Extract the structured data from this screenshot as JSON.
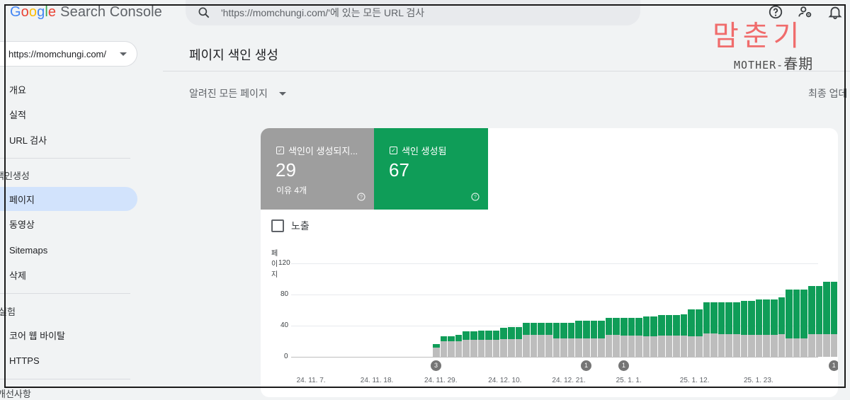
{
  "brand": {
    "logo_word": "Google",
    "product": "Search Console"
  },
  "search": {
    "placeholder": "'https://momchungi.com/'에 있는 모든 URL 검사"
  },
  "top_icons": [
    "help-icon",
    "account-settings-icon",
    "notifications-bell-icon"
  ],
  "property": {
    "label": "https://momchungi.com/"
  },
  "nav": {
    "overview": "개요",
    "performance": "실적",
    "url_inspection": "URL 검사",
    "section_indexing": "색인생성",
    "pages": "페이지",
    "videos": "동영상",
    "sitemaps": "Sitemaps",
    "removals": "삭제",
    "section_experience": "실험",
    "cwv": "코어 웹 바이탈",
    "https": "HTTPS",
    "section_more": "개선사항"
  },
  "page": {
    "title": "페이지 색인 생성",
    "filter": "알려진 모든 페이지",
    "updated": "최종 업데"
  },
  "tiles": {
    "not_indexed": {
      "label": "색인이 생성되지...",
      "count": "29",
      "sub": "이유 4개"
    },
    "indexed": {
      "label": "색인 생성됨",
      "count": "67"
    }
  },
  "impressions_label": "노출",
  "watermark": {
    "kor": "맘춘기",
    "eng": "MOTHER-",
    "han": "春期"
  },
  "colors": {
    "indexed": "#0f9d58",
    "not_indexed": "#bdbdbd",
    "accent": "#1a73e8",
    "active_nav": "#d2e3fc"
  },
  "chart_data": {
    "type": "bar",
    "ylabel": "페이지",
    "y_ticks": [
      "120",
      "80",
      "40",
      "0"
    ],
    "ylim": [
      0,
      120
    ],
    "x_tick_labels": [
      "24. 11. 7.",
      "24. 11. 18.",
      "24. 11. 29.",
      "24. 12. 10.",
      "24. 12. 21.",
      "25. 1. 1.",
      "25. 1. 12.",
      "25. 1. 23."
    ],
    "stacked": true,
    "series": [
      {
        "name": "색인이 생성되지...",
        "values": [
          0,
          0,
          0,
          0,
          0,
          0,
          0,
          0,
          0,
          0,
          0,
          0,
          0,
          0,
          0,
          0,
          0,
          0,
          0,
          0,
          0,
          0,
          0,
          0,
          0,
          0,
          0,
          0,
          0,
          0,
          0,
          0,
          0,
          0,
          0,
          0,
          0,
          0,
          0,
          0,
          0,
          0,
          0,
          0,
          0,
          0,
          0,
          0,
          0,
          0,
          0,
          0,
          0,
          0,
          0,
          0,
          0,
          0,
          0,
          0,
          0,
          0,
          0,
          0,
          0,
          0,
          0,
          0,
          0,
          0,
          0,
          0,
          0,
          0,
          0,
          0,
          0,
          0,
          0,
          0,
          0,
          0,
          0,
          0,
          0,
          0,
          0,
          0,
          0,
          0,
          0,
          0,
          0,
          0,
          0,
          0,
          0,
          0,
          0,
          0,
          0,
          0,
          0,
          0,
          0,
          0,
          0,
          0,
          0,
          0,
          0,
          0
        ]
      },
      {
        "name": "색인 생성됨",
        "values": [
          0,
          0,
          0,
          0,
          0,
          0,
          0,
          0,
          0,
          0,
          0,
          0,
          0,
          0,
          0,
          0,
          0,
          0,
          0,
          0,
          0,
          0,
          0,
          0,
          0,
          0,
          0,
          0,
          0,
          0,
          0,
          0,
          0,
          0,
          0,
          0,
          0,
          0,
          0,
          0,
          0,
          0,
          0,
          0,
          0,
          0,
          0,
          0,
          0,
          0,
          0,
          0,
          0,
          0,
          0,
          0,
          0,
          0,
          0,
          0,
          0,
          0,
          0,
          0,
          0,
          0,
          0,
          0,
          0,
          0,
          0,
          0,
          0,
          0,
          0,
          0,
          0,
          0,
          0,
          0,
          0,
          0,
          0,
          0,
          0,
          0,
          0,
          0,
          0,
          0,
          0,
          0,
          0,
          0,
          0,
          0,
          0,
          0,
          0,
          0,
          0,
          0,
          0,
          0,
          0,
          0,
          0,
          0,
          0,
          0,
          0,
          0
        ]
      }
    ],
    "days": [
      {
        "date": "24. 11. 29.",
        "not_indexed": 12,
        "indexed": 4
      },
      {
        "date": "24. 11. 30.",
        "not_indexed": 20,
        "indexed": 6
      },
      {
        "date": "24. 12. 1.",
        "not_indexed": 20,
        "indexed": 6
      },
      {
        "date": "24. 12. 2.",
        "not_indexed": 20,
        "indexed": 8
      },
      {
        "date": "24. 12. 3.",
        "not_indexed": 22,
        "indexed": 11
      },
      {
        "date": "24. 12. 4.",
        "not_indexed": 22,
        "indexed": 11
      },
      {
        "date": "24. 12. 5.",
        "not_indexed": 22,
        "indexed": 12
      },
      {
        "date": "24. 12. 6.",
        "not_indexed": 22,
        "indexed": 12
      },
      {
        "date": "24. 12. 7.",
        "not_indexed": 22,
        "indexed": 12
      },
      {
        "date": "24. 12. 8.",
        "not_indexed": 23,
        "indexed": 14
      },
      {
        "date": "24. 12. 9.",
        "not_indexed": 23,
        "indexed": 15
      },
      {
        "date": "24. 12. 10.",
        "not_indexed": 23,
        "indexed": 15
      },
      {
        "date": "24. 12. 11.",
        "not_indexed": 28,
        "indexed": 16
      },
      {
        "date": "24. 12. 12.",
        "not_indexed": 28,
        "indexed": 16
      },
      {
        "date": "24. 12. 13.",
        "not_indexed": 28,
        "indexed": 16
      },
      {
        "date": "24. 12. 14.",
        "not_indexed": 28,
        "indexed": 16
      },
      {
        "date": "24. 12. 15.",
        "not_indexed": 24,
        "indexed": 20
      },
      {
        "date": "24. 12. 16.",
        "not_indexed": 24,
        "indexed": 20
      },
      {
        "date": "24. 12. 17.",
        "not_indexed": 24,
        "indexed": 20
      },
      {
        "date": "24. 12. 18.",
        "not_indexed": 24,
        "indexed": 22
      },
      {
        "date": "24. 12. 19.",
        "not_indexed": 24,
        "indexed": 22
      },
      {
        "date": "24. 12. 20.",
        "not_indexed": 24,
        "indexed": 22
      },
      {
        "date": "24. 12. 21.",
        "not_indexed": 24,
        "indexed": 22
      },
      {
        "date": "24. 12. 22.",
        "not_indexed": 28,
        "indexed": 22
      },
      {
        "date": "24. 12. 23.",
        "not_indexed": 28,
        "indexed": 22
      },
      {
        "date": "24. 12. 24.",
        "not_indexed": 27,
        "indexed": 23
      },
      {
        "date": "24. 12. 25.",
        "not_indexed": 27,
        "indexed": 23
      },
      {
        "date": "24. 12. 26.",
        "not_indexed": 27,
        "indexed": 23
      },
      {
        "date": "24. 12. 27.",
        "not_indexed": 26,
        "indexed": 26
      },
      {
        "date": "24. 12. 28.",
        "not_indexed": 26,
        "indexed": 26
      },
      {
        "date": "24. 12. 29.",
        "not_indexed": 27,
        "indexed": 27
      },
      {
        "date": "24. 12. 30.",
        "not_indexed": 27,
        "indexed": 27
      },
      {
        "date": "24. 12. 31.",
        "not_indexed": 27,
        "indexed": 27
      },
      {
        "date": "25. 1. 1.",
        "not_indexed": 27,
        "indexed": 28
      },
      {
        "date": "25. 1. 2.",
        "not_indexed": 26,
        "indexed": 35
      },
      {
        "date": "25. 1. 3.",
        "not_indexed": 26,
        "indexed": 35
      },
      {
        "date": "25. 1. 4.",
        "not_indexed": 30,
        "indexed": 40
      },
      {
        "date": "25. 1. 5.",
        "not_indexed": 30,
        "indexed": 40
      },
      {
        "date": "25. 1. 6.",
        "not_indexed": 29,
        "indexed": 41
      },
      {
        "date": "25. 1. 7.",
        "not_indexed": 29,
        "indexed": 41
      },
      {
        "date": "25. 1. 8.",
        "not_indexed": 29,
        "indexed": 41
      },
      {
        "date": "25. 1. 9.",
        "not_indexed": 28,
        "indexed": 44
      },
      {
        "date": "25. 1. 10.",
        "not_indexed": 28,
        "indexed": 44
      },
      {
        "date": "25. 1. 11.",
        "not_indexed": 28,
        "indexed": 46
      },
      {
        "date": "25. 1. 12.",
        "not_indexed": 28,
        "indexed": 46
      },
      {
        "date": "25. 1. 13.",
        "not_indexed": 28,
        "indexed": 46
      },
      {
        "date": "25. 1. 14.",
        "not_indexed": 29,
        "indexed": 47
      },
      {
        "date": "25. 1. 15.",
        "not_indexed": 24,
        "indexed": 62
      },
      {
        "date": "25. 1. 16.",
        "not_indexed": 24,
        "indexed": 62
      },
      {
        "date": "25. 1. 17.",
        "not_indexed": 24,
        "indexed": 62
      },
      {
        "date": "25. 1. 18.",
        "not_indexed": 29,
        "indexed": 62
      },
      {
        "date": "25. 1. 19.",
        "not_indexed": 29,
        "indexed": 62
      },
      {
        "date": "25. 1. 20.",
        "not_indexed": 29,
        "indexed": 67
      },
      {
        "date": "25. 1. 21.",
        "not_indexed": 29,
        "indexed": 67
      }
    ],
    "annotations": [
      {
        "date": "24. 11. 29.",
        "label": "3"
      },
      {
        "date": "24. 12. 19.",
        "label": "1"
      },
      {
        "date": "24. 12. 24.",
        "label": "1"
      },
      {
        "date": "25. 1. 21.",
        "label": "1"
      }
    ]
  }
}
